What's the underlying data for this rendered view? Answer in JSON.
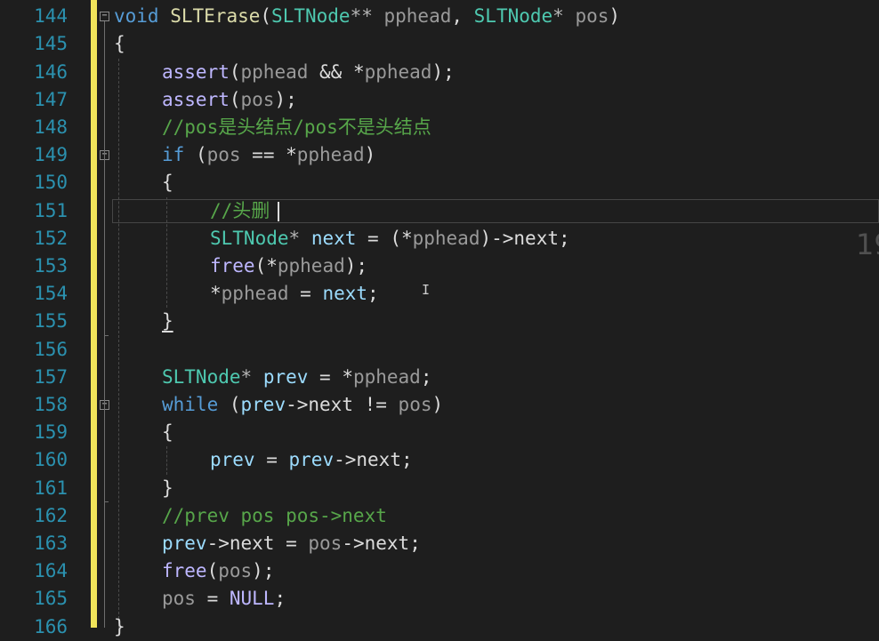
{
  "editor": {
    "line_numbers": [
      "144",
      "145",
      "146",
      "147",
      "148",
      "149",
      "150",
      "151",
      "152",
      "153",
      "154",
      "155",
      "156",
      "157",
      "158",
      "159",
      "160",
      "161",
      "162",
      "163",
      "164",
      "165",
      "166"
    ],
    "lines": {
      "l144": {
        "t1": "void",
        "t2": " ",
        "t3": "SLTErase",
        "t4": "(",
        "t5": "SLTNode",
        "t6": "** ",
        "t7": "pphead",
        "t8": ", ",
        "t9": "SLTNode",
        "t10": "* ",
        "t11": "pos",
        "t12": ")"
      },
      "l145": {
        "t1": "{"
      },
      "l146": {
        "t1": "assert",
        "t2": "(",
        "t3": "pphead",
        "t4": " && *",
        "t5": "pphead",
        "t6": ");"
      },
      "l147": {
        "t1": "assert",
        "t2": "(",
        "t3": "pos",
        "t4": ");"
      },
      "l148": {
        "t1": "//pos是头结点/pos不是头结点"
      },
      "l149": {
        "t1": "if",
        "t2": " (",
        "t3": "pos",
        "t4": " == *",
        "t5": "pphead",
        "t6": ")"
      },
      "l150": {
        "t1": "{"
      },
      "l151": {
        "t1": "//头删"
      },
      "l152": {
        "t1": "SLTNode",
        "t2": "* ",
        "t3": "next",
        "t4": " = (*",
        "t5": "pphead",
        "t6": ")->",
        "t7": "next",
        "t8": ";"
      },
      "l153": {
        "t1": "free",
        "t2": "(*",
        "t3": "pphead",
        "t4": ");"
      },
      "l154": {
        "t1": "*",
        "t2": "pphead",
        "t3": " = ",
        "t4": "next",
        "t5": ";"
      },
      "l155": {
        "t1": "}"
      },
      "l156": {},
      "l157": {
        "t1": "SLTNode",
        "t2": "* ",
        "t3": "prev",
        "t4": " = *",
        "t5": "pphead",
        "t6": ";"
      },
      "l158": {
        "t1": "while",
        "t2": " (",
        "t3": "prev",
        "t4": "->",
        "t5": "next",
        "t6": " != ",
        "t7": "pos",
        "t8": ")"
      },
      "l159": {
        "t1": "{"
      },
      "l160": {
        "t1": "prev",
        "t2": " = ",
        "t3": "prev",
        "t4": "->",
        "t5": "next",
        "t6": ";"
      },
      "l161": {
        "t1": "}"
      },
      "l162": {
        "t1": "//prev pos pos->next"
      },
      "l163": {
        "t1": "prev",
        "t2": "->",
        "t3": "next",
        "t4": " = ",
        "t5": "pos",
        "t6": "->",
        "t7": "next",
        "t8": ";"
      },
      "l164": {
        "t1": "free",
        "t2": "(",
        "t3": "pos",
        "t4": ");"
      },
      "l165": {
        "t1": "pos",
        "t2": " = ",
        "t3": "NULL",
        "t4": ";"
      },
      "l166": {
        "t1": "}"
      }
    },
    "fold_glyphs": {
      "collapse": "−"
    },
    "faded_overlay_text": "19",
    "mouse_cursor_glyph": "I"
  },
  "colors": {
    "background": "#1e1e1e",
    "line_number": "#2b91af",
    "change_bar": "#f0e35a",
    "keyword": "#569cd6",
    "type": "#4ec9b0",
    "function": "#dcdcaa",
    "macro": "#beb7ff",
    "comment": "#57a64a",
    "parameter": "#9a9a9a",
    "local_variable": "#9cdcfe"
  },
  "icons": [
    "fold-collapse-icon",
    "text-cursor-icon"
  ]
}
